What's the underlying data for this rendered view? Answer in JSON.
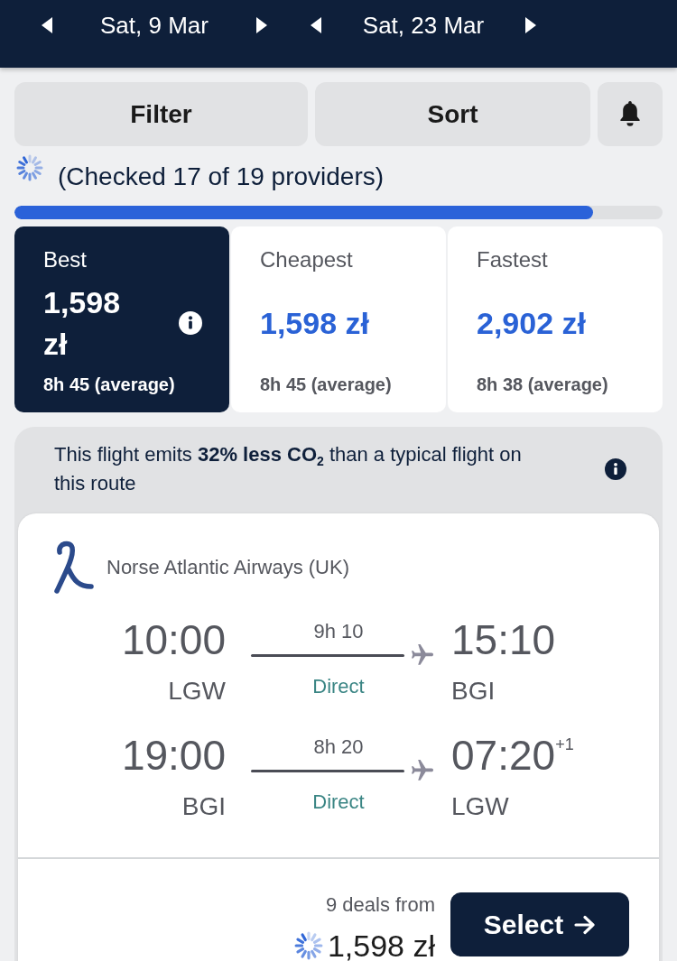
{
  "date_bar": [
    {
      "date": "Sat, 9 Mar"
    },
    {
      "date": "Sat, 23 Mar"
    }
  ],
  "toolbar": {
    "filter": "Filter",
    "sort": "Sort"
  },
  "progress": {
    "text": "(Checked 17 of 19 providers)",
    "level": 0.893
  },
  "sort_tabs": [
    {
      "label": "Best",
      "price": "1,598 zł",
      "duration": "8h 45 (average)",
      "selected": true,
      "info": true
    },
    {
      "label": "Cheapest",
      "price": "1,598 zł",
      "duration": "8h 45 (average)",
      "selected": false,
      "info": false
    },
    {
      "label": "Fastest",
      "price": "2,902 zł",
      "duration": "8h 38 (average)",
      "selected": false,
      "info": false
    }
  ],
  "eco_notice": {
    "text": "This flight emits **32% less CO$_{2}$** than a typical flight on this route"
  },
  "flight": {
    "airline": "Norse Atlantic Airways (UK)",
    "legs": [
      {
        "depart_time": "10:00",
        "depart_airport": "LGW",
        "duration": "9h 10",
        "stops": "Direct",
        "arrive_time": "15:10",
        "arrive_airport": "BGI"
      },
      {
        "depart_time": "19:00",
        "depart_airport": "BGI",
        "duration": "8h 20",
        "stops": "Direct",
        "arrive_time": "07:20",
        "day_offset": "+1",
        "arrive_airport": "LGW"
      }
    ],
    "deals": "9 deals from",
    "price": "1,598 zł",
    "select": "Select"
  }
}
